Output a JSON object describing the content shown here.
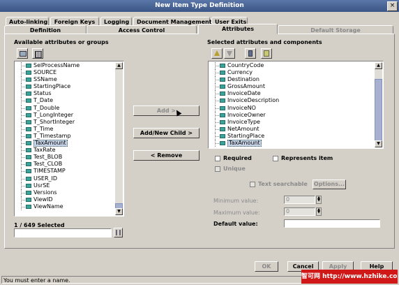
{
  "window": {
    "title": "New Item Type Definition",
    "close_glyph": "×"
  },
  "tabs_row1": [
    "Auto-linking",
    "Foreign Keys",
    "Logging",
    "Document Management",
    "User Exits"
  ],
  "tabs_row2": [
    "Definition",
    "Access Control",
    "Attributes",
    "Default Storage"
  ],
  "left": {
    "heading": "Available attributes or groups",
    "items": [
      "SelProcessName",
      "SOURCE",
      "SSName",
      "StartingPlace",
      "Status",
      "T_Date",
      "T_Double",
      "T_LongInteger",
      "T_ShortInteger",
      "T_Time",
      "T_Timestamp",
      "TaxAmount",
      "TaxRate",
      "Test_BLOB",
      "Test_CLOB",
      "TIMESTAMP",
      "USER_ID",
      "UsrSE",
      "Versions",
      "ViewID",
      "ViewName"
    ],
    "selected_index": 11,
    "count_label": "1 / 649 Selected",
    "search_value": ""
  },
  "middle": {
    "add": "Add >",
    "add_new_child": "Add/New Child >",
    "remove": "< Remove"
  },
  "right": {
    "heading": "Selected attributes and components",
    "items": [
      "CountryCode",
      "Currency",
      "Destination",
      "GrossAmount",
      "InvoiceDate",
      "InvoiceDescription",
      "InvoiceNO",
      "InvoiceOwner",
      "InvoiceType",
      "NetAmount",
      "StartingPlace",
      "TaxAmount"
    ],
    "selected_index": 11,
    "required": "Required",
    "represents_item": "Represents item",
    "unique": "Unique",
    "text_searchable": "Text searchable",
    "options": "Options...",
    "min_label": "Minimum value:",
    "min_value": "0",
    "max_label": "Maximum value:",
    "max_value": "0",
    "default_label": "Default value:",
    "default_value": ""
  },
  "footer": {
    "ok": "OK",
    "cancel": "Cancel",
    "apply": "Apply",
    "help": "Help"
  },
  "status": "You must enter a name.",
  "watermark": "智可网 http://www.hzhike.com"
}
